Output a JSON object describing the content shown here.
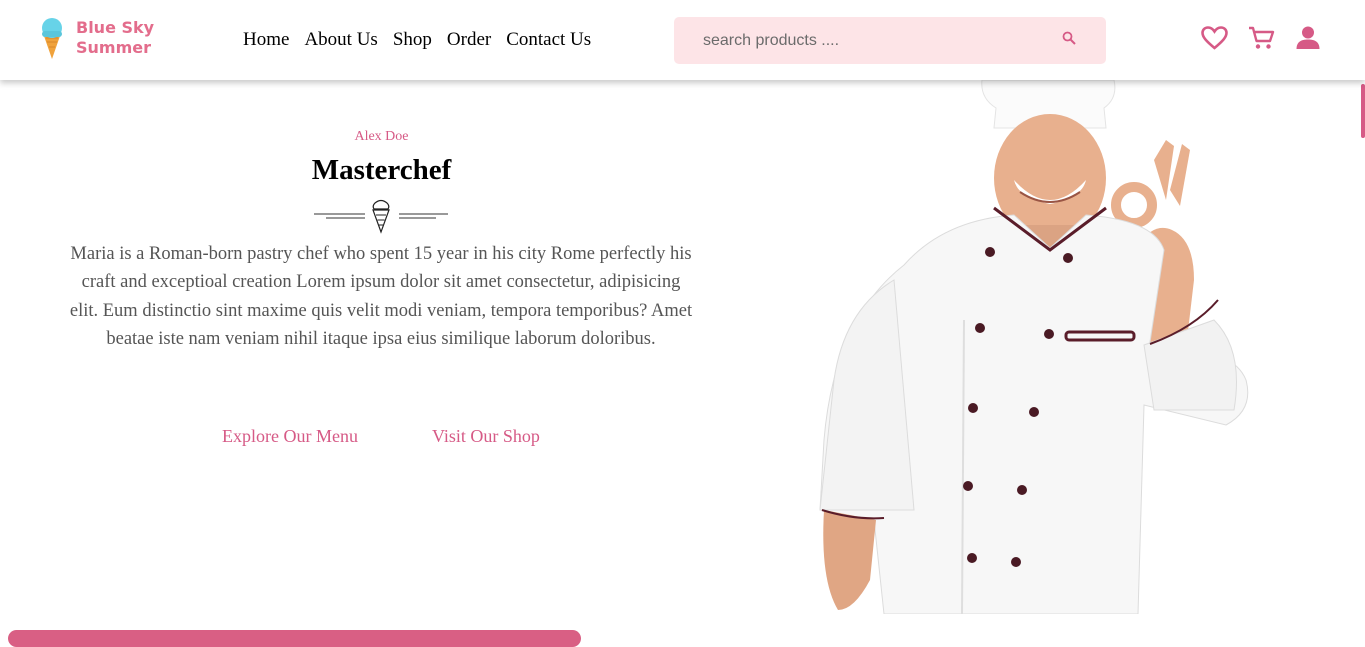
{
  "brand": {
    "line1": "Blue Sky",
    "line2": "Summer",
    "accent": "#e36d8c"
  },
  "nav": [
    {
      "label": "Home"
    },
    {
      "label": "About Us"
    },
    {
      "label": "Shop"
    },
    {
      "label": "Order"
    },
    {
      "label": "Contact Us"
    }
  ],
  "search": {
    "placeholder": "search products ....",
    "value": "",
    "icon": "search-icon",
    "bg": "#fde4e7"
  },
  "header_icons": [
    "heart-icon",
    "cart-icon",
    "user-icon"
  ],
  "hero": {
    "eyebrow": "Alex Doe",
    "title": "Masterchef",
    "divider_icon": "ice-cream-cone-icon",
    "description": "Maria is a Roman-born pastry chef who spent 15 year in his city Rome perfectly his craft and exceptioal creation Lorem ipsum dolor sit amet consectetur, adipisicing elit. Eum distinctio sint maxime quis velit modi veniam, tempora temporibus? Amet beatae iste nam veniam nihil itaque ipsa eius similique laborum doloribus.",
    "cta_primary": "Explore Our Menu",
    "cta_secondary": "Visit Our Shop",
    "accent": "#d65a86"
  },
  "image": {
    "subject": "chef-photo"
  }
}
